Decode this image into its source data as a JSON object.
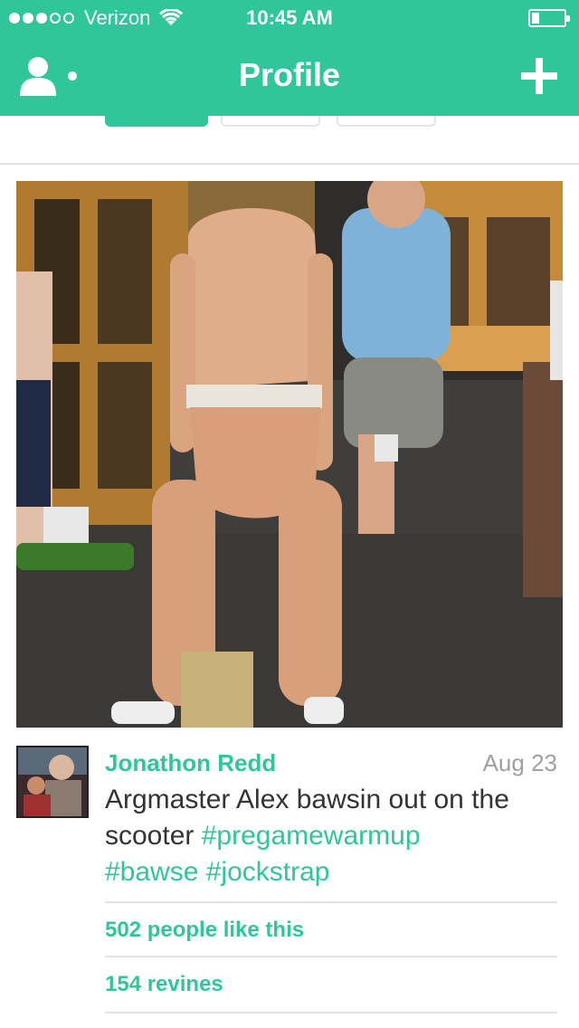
{
  "status_bar": {
    "signal": "●●●○○",
    "carrier": "Verizon",
    "wifi_icon": "wifi-icon",
    "time": "10:45 AM",
    "battery_icon": "battery-low-icon",
    "battery_level": 0.2
  },
  "nav": {
    "title": "Profile",
    "left_icon": "user-icon",
    "right_icon": "plus-icon"
  },
  "colors": {
    "accent": "#2fc69b",
    "text": "#333333",
    "muted": "#a0a0a0",
    "divider": "#e3e3e3"
  },
  "post": {
    "author": "Jonathon Redd",
    "date": "Aug 23",
    "caption_text": "Argmaster Alex bawsin out on the scooter ",
    "hashtags": [
      "#pregamewarmup",
      "#bawse",
      "#jockstrap"
    ],
    "likes": "502 people like this",
    "revines": "154 revines"
  }
}
